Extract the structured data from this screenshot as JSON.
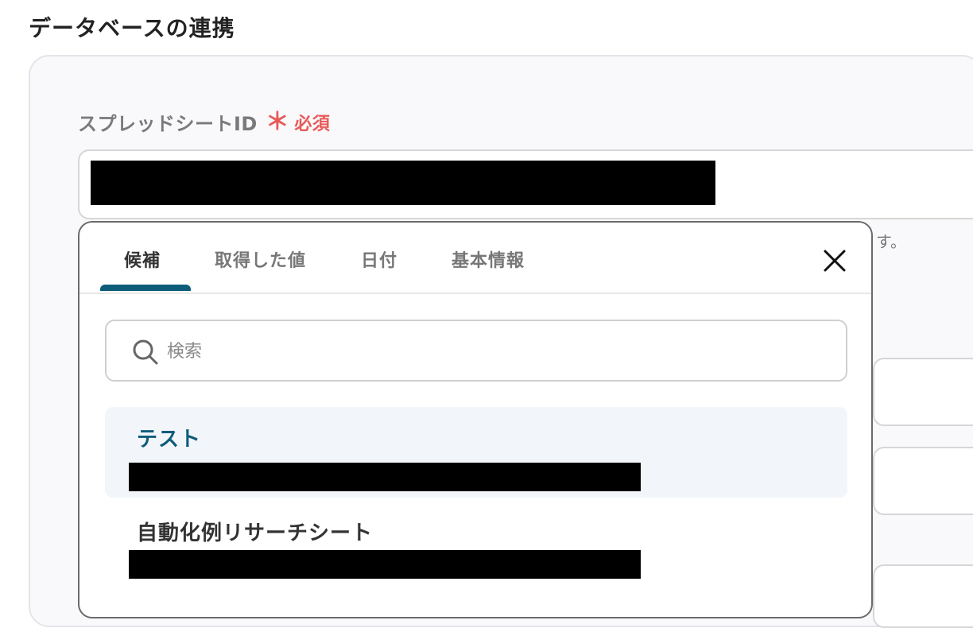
{
  "section": {
    "title": "データベースの連携"
  },
  "field": {
    "label": "スプレッドシートID",
    "required_mark": "＊",
    "required_text": "必須",
    "helper_tail": "す。"
  },
  "dropdown": {
    "tabs": [
      {
        "label": "候補",
        "active": true
      },
      {
        "label": "取得した値",
        "active": false
      },
      {
        "label": "日付",
        "active": false
      },
      {
        "label": "基本情報",
        "active": false
      }
    ],
    "close_icon": "close-icon",
    "search": {
      "placeholder": "検索",
      "value": "",
      "icon": "search-icon"
    },
    "options": [
      {
        "title": "テスト",
        "selected": true
      },
      {
        "title": "自動化例リサーチシート",
        "selected": false
      }
    ]
  },
  "colors": {
    "accent": "#0d5c7a",
    "required": "#e85a5a",
    "selected_bg": "#f2f6fa"
  }
}
